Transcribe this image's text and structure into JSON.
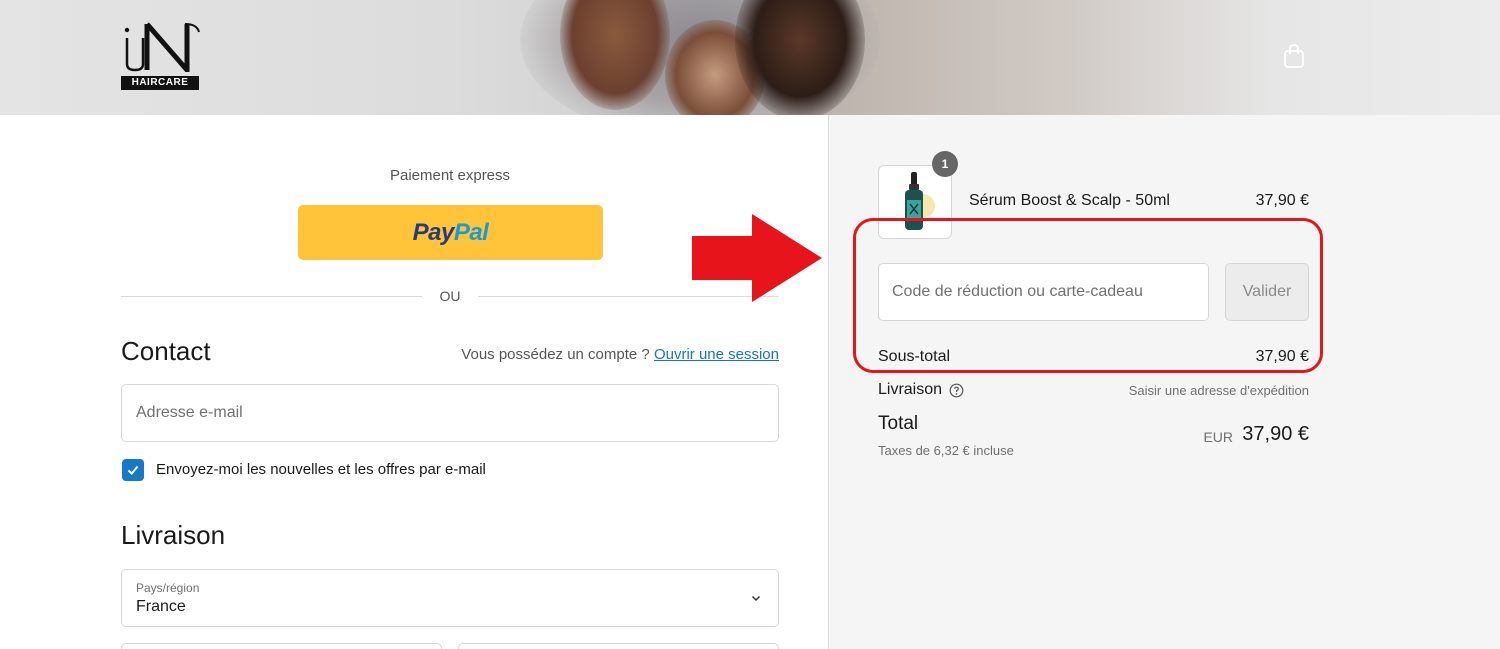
{
  "brand": {
    "logo_text": "HAIRCARE",
    "logo_mark": "uN"
  },
  "header": {
    "cart_icon": "shopping-bag-icon"
  },
  "express": {
    "title": "Paiement express",
    "paypal_pay": "Pay",
    "paypal_pal": "Pal",
    "divider_label": "OU"
  },
  "contact": {
    "title": "Contact",
    "account_prompt": "Vous possédez un compte ?",
    "login_link": "Ouvrir une session",
    "email_placeholder": "Adresse e-mail",
    "newsletter_label": "Envoyez-moi les nouvelles et les offres par e-mail",
    "newsletter_checked": true
  },
  "delivery": {
    "title": "Livraison",
    "country_caption": "Pays/région",
    "country_value": "France"
  },
  "summary": {
    "item": {
      "quantity": "1",
      "name": "Sérum Boost & Scalp - 50ml",
      "price": "37,90 €"
    },
    "discount_placeholder": "Code de réduction ou carte-cadeau",
    "apply_label": "Valider",
    "subtotal_label": "Sous-total",
    "subtotal_value": "37,90 €",
    "shipping_label": "Livraison",
    "shipping_value": "Saisir une adresse d'expédition",
    "total_label": "Total",
    "tax_note": "Taxes de 6,32 € incluse",
    "currency": "EUR",
    "total_value": "37,90 €"
  },
  "colors": {
    "paypal_yellow": "#ffc439",
    "link_blue": "#1a73c2",
    "checkbox_blue": "#1878c8",
    "annotation_red": "#e8141c"
  }
}
